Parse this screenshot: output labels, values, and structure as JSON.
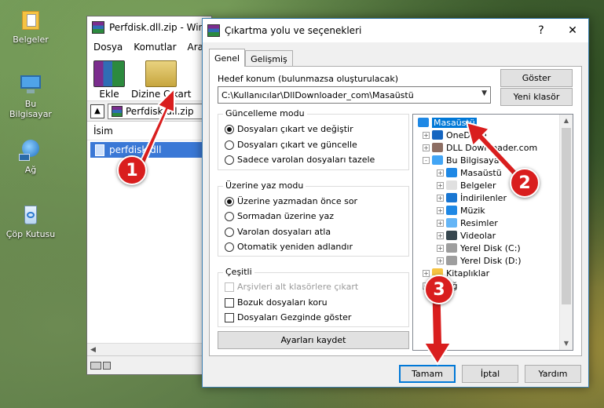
{
  "desktop": {
    "icons": [
      {
        "label": "Belgeler",
        "icon": "folder-documents-icon"
      },
      {
        "label": "Bu Bilgisayar",
        "icon": "computer-icon"
      },
      {
        "label": "Ağ",
        "icon": "network-icon"
      },
      {
        "label": "Çöp Kutusu",
        "icon": "recycle-bin-icon"
      }
    ]
  },
  "winrar": {
    "title": "Perfdisk.dll.zip - Win",
    "menu": [
      "Dosya",
      "Komutlar",
      "Araçla"
    ],
    "toolbar": {
      "add_label": "Ekle",
      "extract_label": "Dizine Çıkart"
    },
    "address": "Perfdisk.dll.zip",
    "column_name": "İsim",
    "file": "perfdisk.dll"
  },
  "dialog": {
    "title": "Çıkartma yolu ve seçenekleri",
    "help_btn": "?",
    "close_btn": "✕",
    "tabs": [
      "Genel",
      "Gelişmiş"
    ],
    "dest_label": "Hedef konum (bulunmazsa oluşturulacak)",
    "dest_value": "C:\\Kullanıcılar\\DllDownloader_com\\Masaüstü",
    "show_btn": "Göster",
    "new_folder_btn": "Yeni klasör",
    "update_group": {
      "title": "Güncelleme modu",
      "options": [
        "Dosyaları çıkart ve değiştir",
        "Dosyaları çıkart ve güncelle",
        "Sadece varolan dosyaları tazele"
      ],
      "selected": 0
    },
    "overwrite_group": {
      "title": "Üzerine yaz modu",
      "options": [
        "Üzerine yazmadan önce sor",
        "Sormadan üzerine yaz",
        "Varolan dosyaları atla",
        "Otomatik yeniden adlandır"
      ],
      "selected": 0
    },
    "misc_group": {
      "title": "Çeşitli",
      "options": [
        {
          "label": "Arşivleri alt klasörlere çıkart",
          "disabled": true
        },
        {
          "label": "Bozuk dosyaları koru",
          "disabled": false
        },
        {
          "label": "Dosyaları Gezginde göster",
          "disabled": false
        }
      ]
    },
    "save_btn": "Ayarları kaydet",
    "tree": [
      {
        "label": "Masaüstü",
        "level": 0,
        "icon": "desktop-icon",
        "color": "#1e88e5",
        "expander": "",
        "selected": true
      },
      {
        "label": "OneDrive",
        "level": 1,
        "icon": "cloud-icon",
        "color": "#1565c0",
        "expander": "+"
      },
      {
        "label": "DLL Downloader.com",
        "level": 1,
        "icon": "user-icon",
        "color": "#8d6e63",
        "expander": "+"
      },
      {
        "label": "Bu Bilgisayar",
        "level": 1,
        "icon": "computer-icon",
        "color": "#42a5f5",
        "expander": "-"
      },
      {
        "label": "Masaüstü",
        "level": 2,
        "icon": "desktop-icon",
        "color": "#1e88e5",
        "expander": "+"
      },
      {
        "label": "Belgeler",
        "level": 2,
        "icon": "document-icon",
        "color": "#e0e0e0",
        "expander": "+"
      },
      {
        "label": "İndirilenler",
        "level": 2,
        "icon": "download-icon",
        "color": "#1976d2",
        "expander": "+"
      },
      {
        "label": "Müzik",
        "level": 2,
        "icon": "music-icon",
        "color": "#1e88e5",
        "expander": "+"
      },
      {
        "label": "Resimler",
        "level": 2,
        "icon": "pictures-icon",
        "color": "#64b5f6",
        "expander": "+"
      },
      {
        "label": "Videolar",
        "level": 2,
        "icon": "video-icon",
        "color": "#37474f",
        "expander": "+"
      },
      {
        "label": "Yerel Disk (C:)",
        "level": 2,
        "icon": "disk-icon",
        "color": "#9e9e9e",
        "expander": "+"
      },
      {
        "label": "Yerel Disk (D:)",
        "level": 2,
        "icon": "disk-icon",
        "color": "#9e9e9e",
        "expander": "+"
      },
      {
        "label": "Kitaplıklar",
        "level": 1,
        "icon": "library-icon",
        "color": "#f6c342",
        "expander": "+"
      },
      {
        "label": "Ağ",
        "level": 1,
        "icon": "network-icon",
        "color": "#42a5f5",
        "expander": "+"
      }
    ],
    "ok_btn": "Tamam",
    "cancel_btn": "İptal",
    "help2_btn": "Yardım"
  },
  "annotations": {
    "step1": "1",
    "step2": "2",
    "step3": "3",
    "color": "#d91e1e"
  }
}
